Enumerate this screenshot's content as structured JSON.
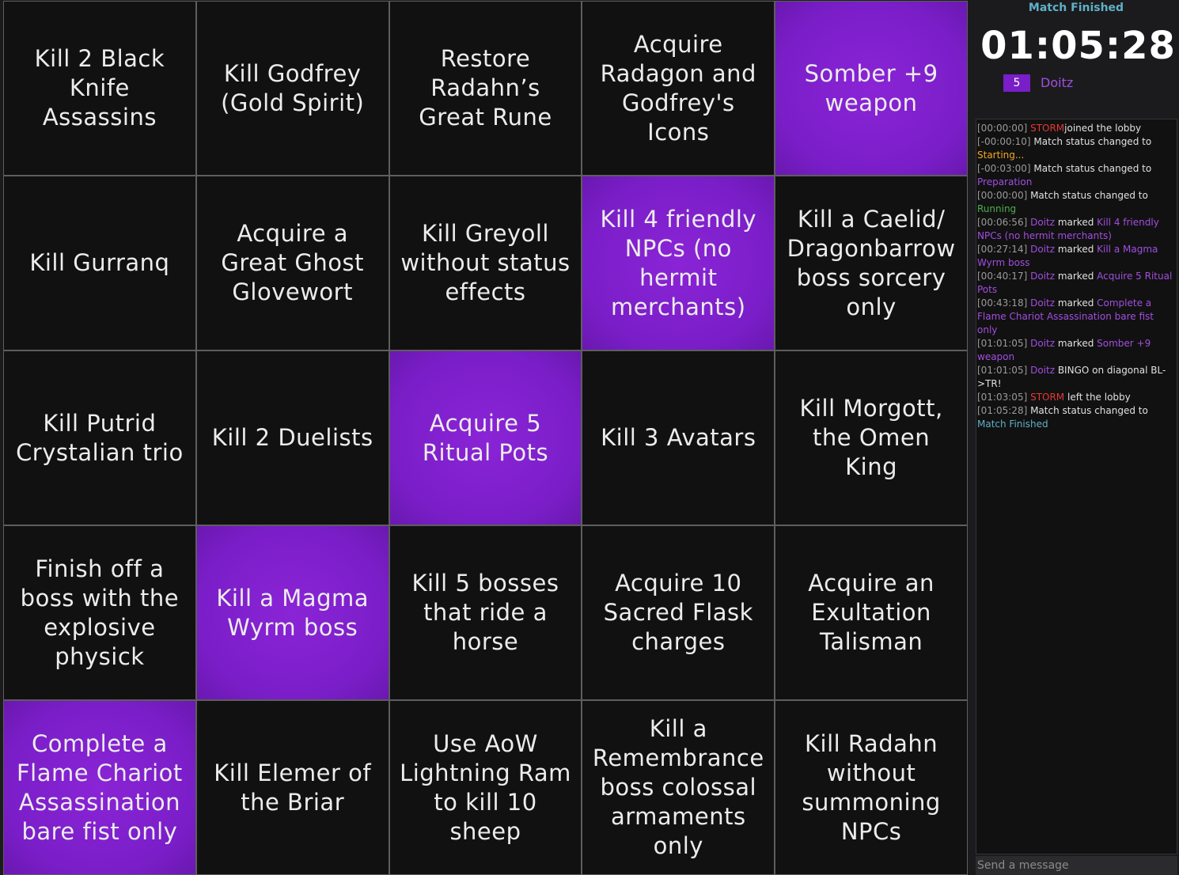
{
  "colors": {
    "marked": "#7a1ec8",
    "unmarked": "#111111",
    "accent_teal": "#5fb1c8",
    "accent_red": "#e53935",
    "accent_purple": "#a24ee0"
  },
  "board": {
    "cells": [
      {
        "label": "Kill 2 Black Knife Assassins",
        "marked": false
      },
      {
        "label": "Kill Godfrey (Gold Spirit)",
        "marked": false
      },
      {
        "label": "Restore Radahn’s Great Rune",
        "marked": false
      },
      {
        "label": "Acquire Radagon and Godfrey's Icons",
        "marked": false
      },
      {
        "label": "Somber +9 weapon",
        "marked": true
      },
      {
        "label": "Kill Gurranq",
        "marked": false
      },
      {
        "label": "Acquire a Great Ghost Glovewort",
        "marked": false
      },
      {
        "label": "Kill Greyoll without status effects",
        "marked": false
      },
      {
        "label": "Kill 4 friendly NPCs (no hermit merchants)",
        "marked": true
      },
      {
        "label": "Kill a Caelid/ Dragonbarrow boss sorcery only",
        "marked": false
      },
      {
        "label": "Kill Putrid Crystalian trio",
        "marked": false
      },
      {
        "label": "Kill 2 Duelists",
        "marked": false
      },
      {
        "label": "Acquire 5 Ritual Pots",
        "marked": true
      },
      {
        "label": "Kill 3 Avatars",
        "marked": false
      },
      {
        "label": "Kill Morgott, the Omen King",
        "marked": false
      },
      {
        "label": "Finish off a boss with the explosive physick",
        "marked": false
      },
      {
        "label": "Kill a Magma Wyrm boss",
        "marked": true
      },
      {
        "label": "Kill 5 bosses that ride a horse",
        "marked": false
      },
      {
        "label": "Acquire 10 Sacred Flask charges",
        "marked": false
      },
      {
        "label": "Acquire an Exultation Talisman",
        "marked": false
      },
      {
        "label": "Complete a Flame Chariot Assassination bare fist only",
        "marked": true
      },
      {
        "label": "Kill Elemer of the Briar",
        "marked": false
      },
      {
        "label": "Use AoW Lightning Ram to kill 10 sheep",
        "marked": false
      },
      {
        "label": "Kill a Remembrance boss colossal armaments only",
        "marked": false
      },
      {
        "label": "Kill Radahn without summoning NPCs",
        "marked": false
      }
    ]
  },
  "sidebar": {
    "status": "Match Finished",
    "timer": "01:05:28",
    "player": {
      "score": "5",
      "name": "Doitz"
    },
    "log": [
      [
        [
          "ts",
          "[00:00:00]"
        ],
        [
          "red",
          " STORM"
        ],
        [
          "",
          "joined the lobby"
        ]
      ],
      [
        [
          "ts",
          "[-00:00:10]"
        ],
        [
          "",
          " Match status changed to "
        ],
        [
          "orange",
          "Starting..."
        ]
      ],
      [
        [
          "ts",
          "[-00:03:00]"
        ],
        [
          "",
          " Match status changed to "
        ],
        [
          "purple",
          "Preparation"
        ]
      ],
      [
        [
          "ts",
          "[00:00:00]"
        ],
        [
          "",
          " Match status changed to "
        ],
        [
          "green",
          "Running"
        ]
      ],
      [
        [
          "ts",
          "[00:06:56]"
        ],
        [
          "purple",
          " Doitz"
        ],
        [
          "",
          " marked "
        ],
        [
          "purple",
          "Kill 4 friendly NPCs (no hermit merchants)"
        ]
      ],
      [
        [
          "ts",
          "[00:27:14]"
        ],
        [
          "purple",
          " Doitz"
        ],
        [
          "",
          " marked "
        ],
        [
          "purple",
          "Kill a Magma Wyrm boss"
        ]
      ],
      [
        [
          "ts",
          "[00:40:17]"
        ],
        [
          "purple",
          " Doitz"
        ],
        [
          "",
          " marked "
        ],
        [
          "purple",
          "Acquire 5 Ritual Pots"
        ]
      ],
      [
        [
          "ts",
          "[00:43:18]"
        ],
        [
          "purple",
          " Doitz"
        ],
        [
          "",
          " marked "
        ],
        [
          "purple",
          "Complete a Flame Chariot Assassination bare fist only"
        ]
      ],
      [
        [
          "ts",
          "[01:01:05]"
        ],
        [
          "purple",
          " Doitz"
        ],
        [
          "",
          " marked "
        ],
        [
          "purple",
          "Somber +9 weapon"
        ]
      ],
      [
        [
          "ts",
          "[01:01:05]"
        ],
        [
          "purple",
          " Doitz"
        ],
        [
          "",
          " BINGO on diagonal BL->TR!"
        ]
      ],
      [
        [
          "ts",
          "[01:03:05]"
        ],
        [
          "red",
          " STORM"
        ],
        [
          "",
          " left the lobby"
        ]
      ],
      [
        [
          "ts",
          "[01:05:28]"
        ],
        [
          "",
          " Match status changed to "
        ],
        [
          "teal",
          "Match Finished"
        ]
      ]
    ],
    "chat_placeholder": "Send a message"
  }
}
